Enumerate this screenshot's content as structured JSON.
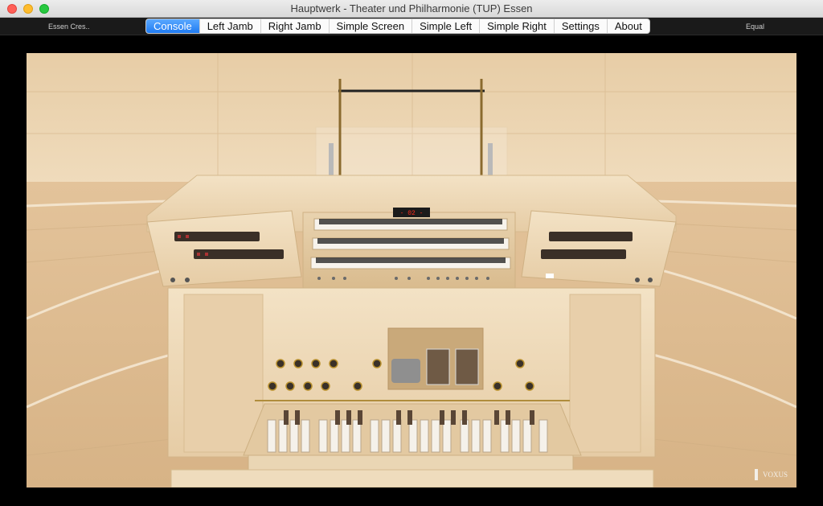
{
  "window": {
    "title": "Hauptwerk - Theater und Philharmonie (TUP) Essen"
  },
  "toolbar": {
    "left_label": "Essen Cres..",
    "right_label": "Equal",
    "tabs": [
      {
        "label": "Console",
        "active": true
      },
      {
        "label": "Left Jamb"
      },
      {
        "label": "Right Jamb"
      },
      {
        "label": "Simple Screen"
      },
      {
        "label": "Simple Left"
      },
      {
        "label": "Simple Right"
      },
      {
        "label": "Settings"
      },
      {
        "label": "About"
      }
    ]
  },
  "console": {
    "display_readout": "- 02 -",
    "brand": "VOXUS"
  },
  "colors": {
    "accent": "#1f7bf2",
    "wood": "#e8cfa9"
  },
  "icons": [
    "close-icon",
    "minimize-icon",
    "zoom-icon",
    "voxus-logo-icon"
  ]
}
